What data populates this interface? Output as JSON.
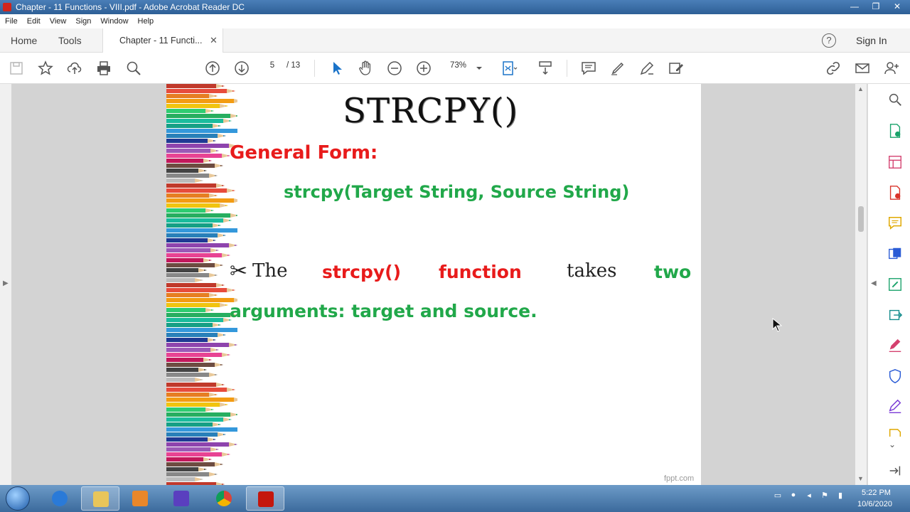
{
  "window": {
    "title": "Chapter - 11 Functions - VIII.pdf - Adobe Acrobat Reader DC",
    "minimize": "—",
    "maximize": "❐",
    "close": "✕"
  },
  "menu": [
    "File",
    "Edit",
    "View",
    "Sign",
    "Window",
    "Help"
  ],
  "tabs": {
    "home": "Home",
    "tools": "Tools",
    "document": "Chapter - 11 Functi...",
    "document_close": "✕"
  },
  "header": {
    "help": "?",
    "signin": "Sign In"
  },
  "toolbar": {
    "page_current": "5",
    "page_total": "/ 13",
    "zoom": "73%",
    "icons": [
      "save-icon",
      "star-icon",
      "upload-icon",
      "print-icon",
      "search-icon",
      "prev-page-icon",
      "next-page-icon",
      "select-arrow-icon",
      "hand-icon",
      "zoom-out-icon",
      "zoom-in-icon",
      "fit-page-icon",
      "scroll-mode-icon",
      "comment-icon",
      "highlight-icon",
      "sign-icon",
      "share-edit-icon",
      "link-icon",
      "mail-icon",
      "add-user-icon"
    ]
  },
  "slide": {
    "title": "STRCPY()",
    "general_form": "General Form:",
    "syntax": "strcpy(Target String, Source String)",
    "bullet": "✂",
    "line1": {
      "the": "The",
      "fn": "strcpy()",
      "function": "function",
      "takes": "takes",
      "two": "two"
    },
    "line2": "arguments: target and source.",
    "watermark": "fppt.com"
  },
  "colors": {
    "title_red": "#e81b1b",
    "green": "#21a84a",
    "accent_blue": "#1a73c9"
  },
  "taskbar": {
    "time": "5:22 PM",
    "date": "10/6/2020"
  }
}
